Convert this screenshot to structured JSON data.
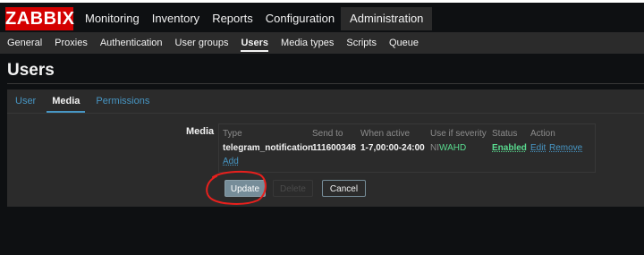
{
  "brand": {
    "logo_text": "ZABBIX",
    "logo_color": "#d40000"
  },
  "main_menu": [
    "Monitoring",
    "Inventory",
    "Reports",
    "Configuration",
    "Administration"
  ],
  "main_menu_active": "Administration",
  "sub_menu": [
    "General",
    "Proxies",
    "Authentication",
    "User groups",
    "Users",
    "Media types",
    "Scripts",
    "Queue"
  ],
  "sub_menu_active": "Users",
  "page": {
    "title": "Users"
  },
  "form_tabs": [
    "User",
    "Media",
    "Permissions"
  ],
  "form_tabs_active": "Media",
  "media": {
    "label": "Media",
    "columns": [
      "Type",
      "Send to",
      "When active",
      "Use if severity",
      "Status",
      "Action"
    ],
    "rows": [
      {
        "type": "telegram_notification",
        "send_to": "111600348",
        "when_active": "1-7,00:00-24:00",
        "severity_inactive": "NI",
        "severity_active": "WAHD",
        "status": "Enabled",
        "action_edit": "Edit",
        "action_remove": "Remove"
      }
    ],
    "add_label": "Add"
  },
  "buttons": {
    "update": "Update",
    "delete": "Delete",
    "cancel": "Cancel"
  },
  "colors": {
    "background": "#0e1012",
    "panel": "#2b2b2b",
    "link": "#4796c4",
    "enabled_green": "#59db8f",
    "annotation_red": "#e8201d"
  }
}
